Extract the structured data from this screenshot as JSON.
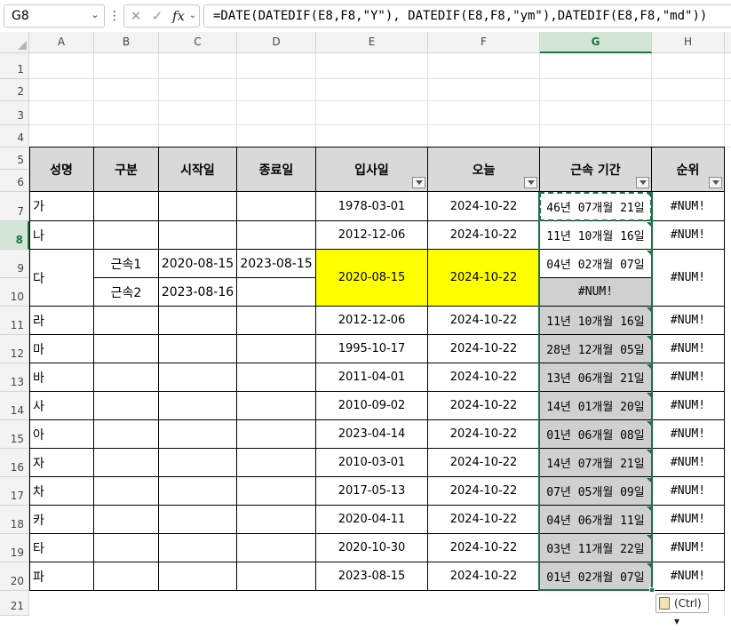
{
  "formula_bar": {
    "name_box": "G8",
    "formula": "=DATE(DATEDIF(E8,F8,\"Y\"), DATEDIF(E8,F8,\"ym\"),DATEDIF(E8,F8,\"md\"))",
    "fx_label": "fx"
  },
  "columns": [
    "A",
    "B",
    "C",
    "D",
    "E",
    "F",
    "G",
    "H"
  ],
  "rows": [
    "1",
    "2",
    "3",
    "4",
    "5",
    "6",
    "7",
    "8",
    "9",
    "10",
    "11",
    "12",
    "13",
    "14",
    "15",
    "16",
    "17",
    "18",
    "19",
    "20",
    "21"
  ],
  "headers": {
    "name": "성명",
    "category": "구분",
    "start": "시작일",
    "end": "종료일",
    "hire": "입사일",
    "today": "오늘",
    "tenure": "근속 기간",
    "rank": "순위"
  },
  "records": [
    {
      "name": "가",
      "hire": "1978-03-01",
      "today": "2024-10-22",
      "tenure": "46년 07개월 21일",
      "rank": "#NUM!"
    },
    {
      "name": "나",
      "hire": "2012-12-06",
      "today": "2024-10-22",
      "tenure": "11년 10개월 16일",
      "rank": "#NUM!"
    },
    {
      "name": "다",
      "cat1": "근속1",
      "start1": "2020-08-15",
      "end1": "2023-08-15",
      "cat2": "근속2",
      "start2": "2023-08-16",
      "hire": "2020-08-15",
      "today": "2024-10-22",
      "tenure1": "04년 02개월 07일",
      "tenure2": "#NUM!",
      "rank": "#NUM!"
    },
    {
      "name": "라",
      "hire": "2012-12-06",
      "today": "2024-10-22",
      "tenure": "11년 10개월 16일",
      "rank": "#NUM!"
    },
    {
      "name": "마",
      "hire": "1995-10-17",
      "today": "2024-10-22",
      "tenure": "28년 12개월 05일",
      "rank": "#NUM!"
    },
    {
      "name": "바",
      "hire": "2011-04-01",
      "today": "2024-10-22",
      "tenure": "13년 06개월 21일",
      "rank": "#NUM!"
    },
    {
      "name": "사",
      "hire": "2010-09-02",
      "today": "2024-10-22",
      "tenure": "14년 01개월 20일",
      "rank": "#NUM!"
    },
    {
      "name": "아",
      "hire": "2023-04-14",
      "today": "2024-10-22",
      "tenure": "01년 06개월 08일",
      "rank": "#NUM!"
    },
    {
      "name": "자",
      "hire": "2010-03-01",
      "today": "2024-10-22",
      "tenure": "14년 07개월 21일",
      "rank": "#NUM!"
    },
    {
      "name": "차",
      "hire": "2017-05-13",
      "today": "2024-10-22",
      "tenure": "07년 05개월 09일",
      "rank": "#NUM!"
    },
    {
      "name": "카",
      "hire": "2020-04-11",
      "today": "2024-10-22",
      "tenure": "04년 06개월 11일",
      "rank": "#NUM!"
    },
    {
      "name": "타",
      "hire": "2020-10-30",
      "today": "2024-10-22",
      "tenure": "03년 11개월 22일",
      "rank": "#NUM!"
    },
    {
      "name": "파",
      "hire": "2023-08-15",
      "today": "2024-10-22",
      "tenure": "01년 02개월 07일",
      "rank": "#NUM!"
    }
  ],
  "paste_options": {
    "label": "(Ctrl)",
    "arrow": "▾"
  }
}
